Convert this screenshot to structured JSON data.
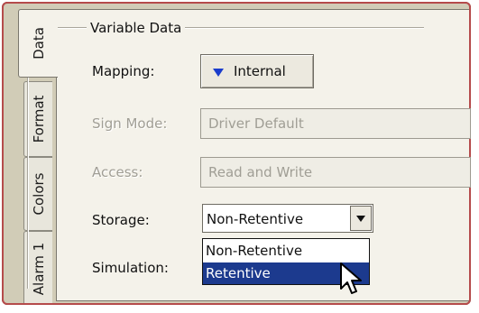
{
  "tabs": [
    {
      "label": "Data",
      "active": true
    },
    {
      "label": "Format",
      "active": false
    },
    {
      "label": "Colors",
      "active": false
    },
    {
      "label": "Alarm 1",
      "active": false
    }
  ],
  "group": {
    "title": "Variable Data"
  },
  "mapping": {
    "label": "Mapping:",
    "button": "Internal",
    "icon": "triangle-down-icon",
    "icon_color": "#1a3ccc"
  },
  "sign_mode": {
    "label": "Sign Mode:",
    "value": "Driver Default"
  },
  "access": {
    "label": "Access:",
    "value": "Read and Write"
  },
  "storage": {
    "label": "Storage:",
    "selected": "Non-Retentive",
    "options": [
      "Non-Retentive",
      "Retentive"
    ],
    "highlighted": "Retentive"
  },
  "simulation": {
    "label": "Simulation:"
  },
  "colors": {
    "highlight": "#1c3a8e",
    "panel": "#f4f2ea",
    "frame_border": "#b54b4b"
  }
}
